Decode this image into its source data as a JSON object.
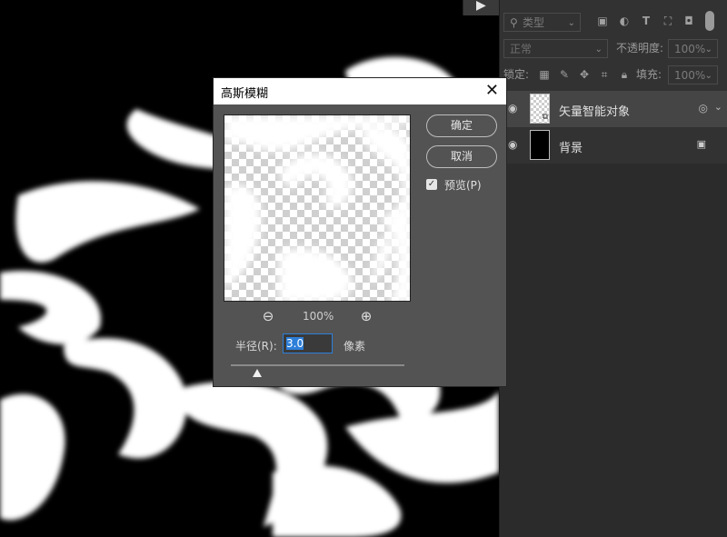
{
  "canvas": {
    "play_icon": "▶"
  },
  "layers_panel": {
    "filter_select": "类型",
    "filter_icons": [
      "image-icon",
      "adjustment-icon",
      "type-icon",
      "shape-icon",
      "smart-object-icon",
      "toggle-icon"
    ],
    "blend_mode": "正常",
    "opacity_label": "不透明度:",
    "opacity_value": "100%",
    "lock_label": "锁定:",
    "fill_label": "填充:",
    "fill_value": "100%",
    "layers": [
      {
        "name": "矢量智能对象",
        "visible": true,
        "active": true
      },
      {
        "name": "背景",
        "visible": true,
        "active": false
      }
    ]
  },
  "dialog": {
    "title": "高斯模糊",
    "close_icon": "✕",
    "ok_label": "确定",
    "cancel_label": "取消",
    "preview_label": "预览(P)",
    "preview_checked": true,
    "zoom_value": "100%",
    "radius_label": "半径(R):",
    "radius_value": "3.0",
    "unit_label": "像素",
    "slider_value": 0.15
  }
}
